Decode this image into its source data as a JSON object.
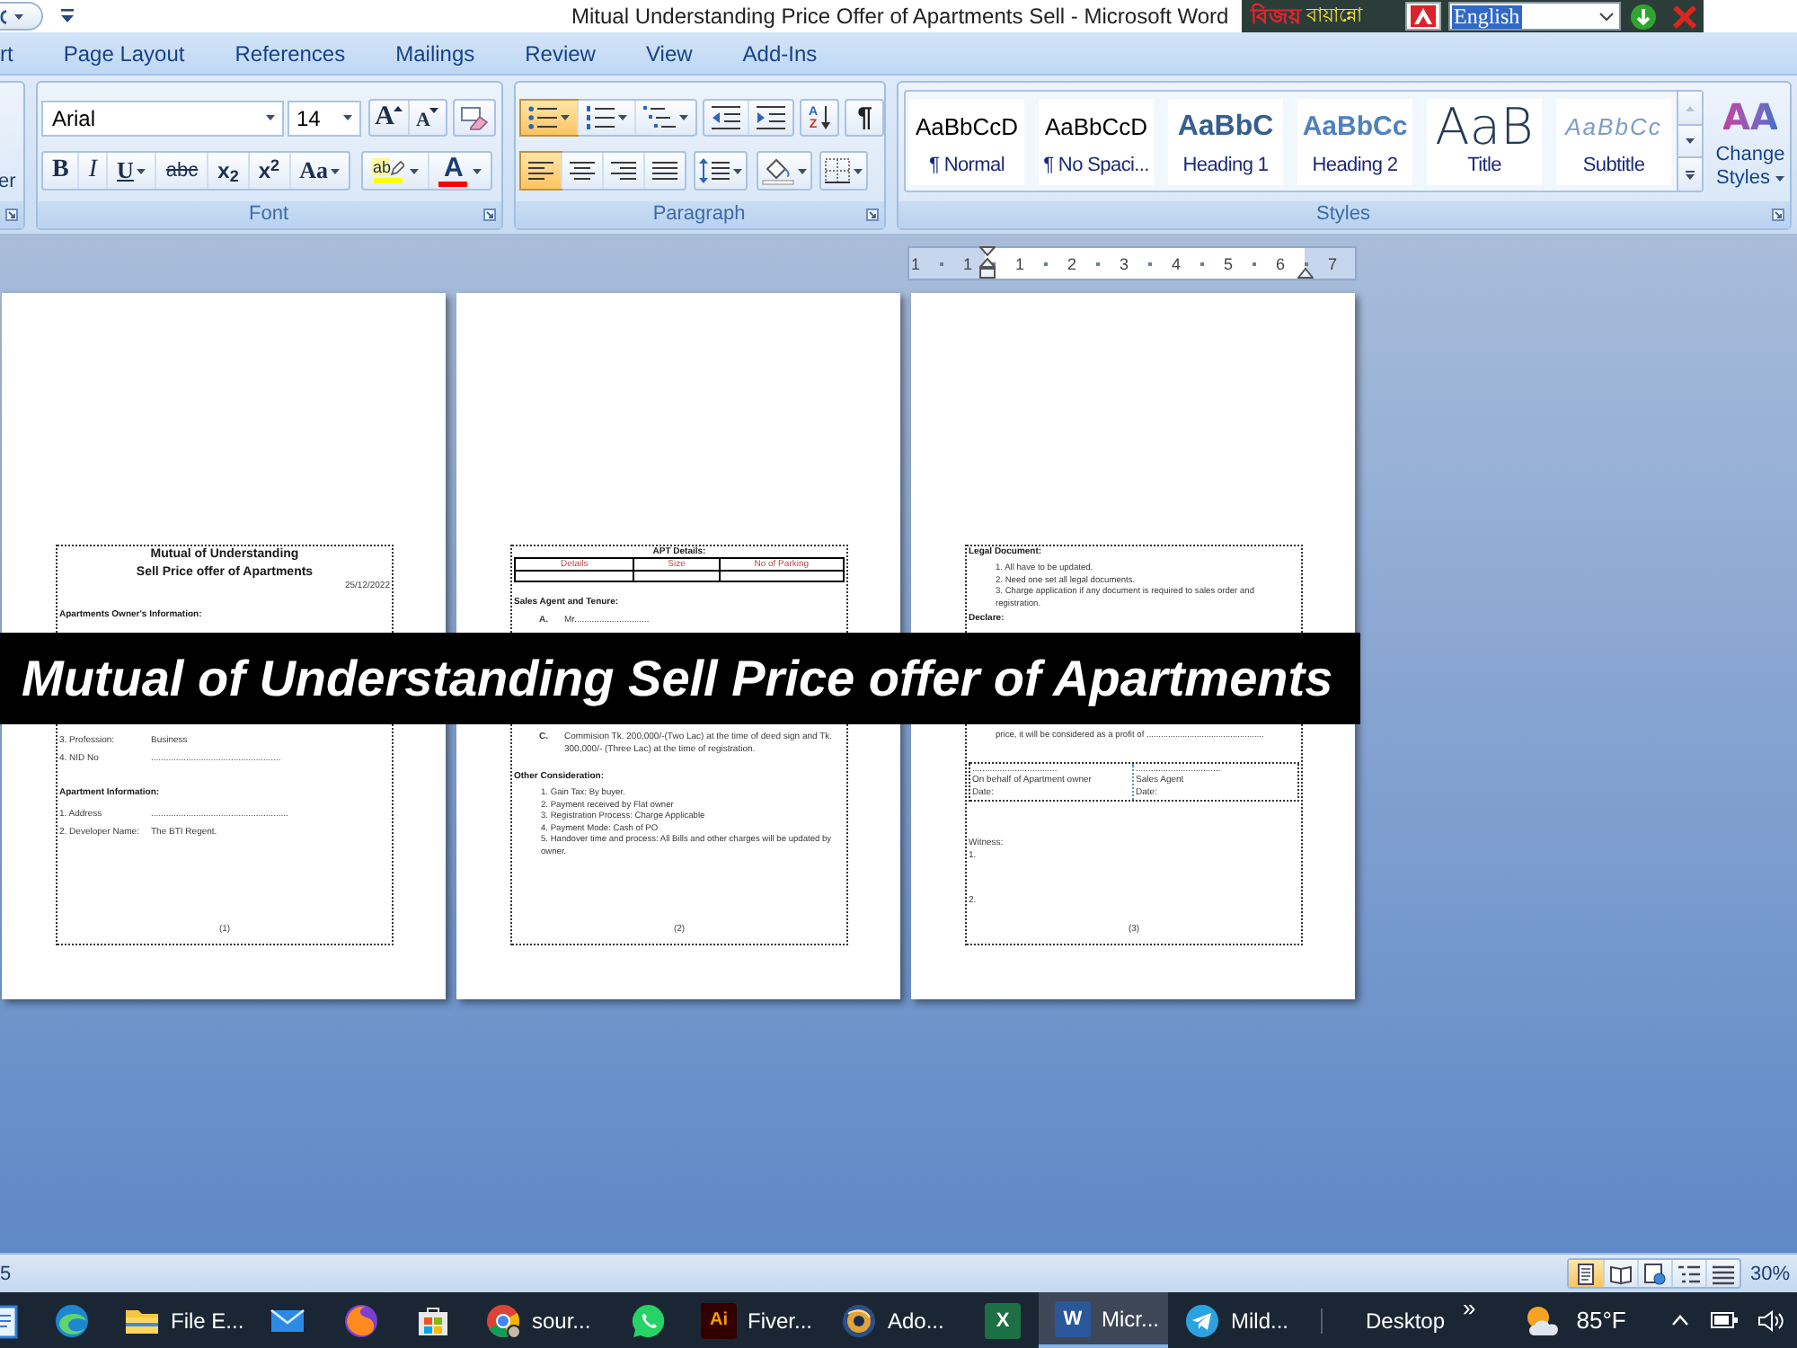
{
  "title_bar": {
    "title": "Mitual Understanding Price Offer of Apartments Sell - Microsoft Word"
  },
  "input_toolbar": {
    "logo": "বিজয়",
    "product": "বায়ান্নো",
    "language": "English"
  },
  "tabs": [
    {
      "label": "rt",
      "selected": false
    },
    {
      "label": "Page Layout",
      "selected": false
    },
    {
      "label": "References",
      "selected": false
    },
    {
      "label": "Mailings",
      "selected": false
    },
    {
      "label": "Review",
      "selected": false
    },
    {
      "label": "View",
      "selected": false
    },
    {
      "label": "Add-Ins",
      "selected": false
    }
  ],
  "clipboard_group": {
    "button_label": "er"
  },
  "font_group": {
    "label": "Font",
    "font_name": "Arial",
    "font_size": "14",
    "size_buttons": [
      {
        "kind": "grow",
        "glyph": "A"
      },
      {
        "kind": "shrink",
        "glyph": "A"
      }
    ],
    "format_buttons": [
      {
        "kind": "bold",
        "glyph": "B",
        "menu": false
      },
      {
        "kind": "italic",
        "glyph": "I",
        "menu": false
      },
      {
        "kind": "underline",
        "glyph": "U",
        "menu": true
      },
      {
        "kind": "strike",
        "glyph": "abc",
        "menu": false
      },
      {
        "kind": "subscript",
        "glyph": "x$_{2}$",
        "menu": false
      },
      {
        "kind": "superscript",
        "glyph": "x$^{2}$",
        "menu": false
      },
      {
        "kind": "case",
        "glyph": "Aa",
        "menu": true
      }
    ],
    "color_buttons": [
      {
        "kind": "highlight",
        "glyph": "ab",
        "color": "#ffff00"
      },
      {
        "kind": "font_color",
        "glyph": "A",
        "color": "#ff0000"
      }
    ]
  },
  "paragraph_group": {
    "label": "Paragraph",
    "rows": [
      [
        [
          {
            "kind": "bullets",
            "on": true,
            "menu": true
          },
          {
            "kind": "numbering",
            "on": false,
            "menu": true
          },
          {
            "kind": "multilevel",
            "on": false,
            "menu": true
          }
        ],
        [
          {
            "kind": "outdent",
            "on": false,
            "menu": false
          },
          {
            "kind": "indent",
            "on": false,
            "menu": false
          }
        ],
        [
          {
            "kind": "sort",
            "on": false,
            "menu": false,
            "glyphs": [
              "A",
              "Z"
            ]
          }
        ],
        [
          {
            "kind": "pilcrow",
            "on": false,
            "menu": false,
            "glyph": "¶"
          }
        ]
      ],
      [
        [
          {
            "kind": "align_left",
            "on": true,
            "menu": false
          },
          {
            "kind": "align_center",
            "on": false,
            "menu": false
          },
          {
            "kind": "align_right",
            "on": false,
            "menu": false
          },
          {
            "kind": "justify",
            "on": false,
            "menu": false
          }
        ],
        [
          {
            "kind": "line_spacing",
            "on": false,
            "menu": true
          }
        ],
        [
          {
            "kind": "shading",
            "on": false,
            "menu": true
          }
        ],
        [
          {
            "kind": "borders",
            "on": false,
            "menu": true
          }
        ]
      ]
    ]
  },
  "styles_group": {
    "label": "Styles",
    "gallery": [
      {
        "kind": "normal",
        "preview": "AaBbCcD",
        "label": "¶ Normal",
        "selected": false
      },
      {
        "kind": "no_spacing",
        "preview": "AaBbCcD",
        "label": "¶ No Spaci...",
        "selected": false
      },
      {
        "kind": "heading1",
        "preview": "AaBbC",
        "label": "Heading 1",
        "selected": false
      },
      {
        "kind": "heading2",
        "preview": "AaBbCc",
        "label": "Heading 2",
        "selected": false
      },
      {
        "kind": "title",
        "preview": "AaB",
        "label": "Title",
        "selected": false
      },
      {
        "kind": "subtitle",
        "preview": "AaBbCc",
        "label": "Subtitle",
        "selected": false
      }
    ],
    "scroll_up": {
      "disabled": true
    },
    "change_styles": {
      "glyph": "AA",
      "label": "Change Styles"
    }
  },
  "ruler": {
    "labels": [
      "1",
      "1",
      "1",
      "2",
      "3",
      "4",
      "5",
      "6",
      "7"
    ]
  },
  "pages": [
    {
      "top": [
        {
          "kind": "title",
          "text": "Mutual of Understanding"
        },
        {
          "kind": "title",
          "text": "Sell Price offer of Apartments"
        },
        {
          "kind": "date",
          "text": "25/12/2022"
        },
        {
          "kind": "heading",
          "text": "Apartments Owner's Information:"
        }
      ],
      "bottom": [
        {
          "kind": "field",
          "label": "3. Profession:",
          "value": "Business"
        },
        {
          "kind": "field",
          "label": "4. NID No",
          "value": "...................................................."
        },
        {
          "kind": "heading",
          "text": "Apartment Information:"
        },
        {
          "kind": "field",
          "label": "1. Address",
          "value": "......................................................."
        },
        {
          "kind": "field",
          "label": "2. Developer Name:",
          "value": "The BTI Regent."
        }
      ],
      "page_number": "(1)"
    },
    {
      "top": [
        {
          "kind": "center_heading",
          "text": "APT Details:"
        },
        {
          "kind": "table",
          "columns": [
            "Details",
            "Size",
            "No of Parking"
          ]
        },
        {
          "kind": "heading",
          "text": "Sales Agent and Tenure:"
        },
        {
          "kind": "lettered",
          "marker": "A.",
          "text": "Mr.............................."
        }
      ],
      "bottom": [
        {
          "kind": "lettered",
          "marker": "C.",
          "text": "Commision Tk. 200,000/-(Two Lac) at the time of deed sign and Tk. 300,000/- (Three Lac) at the time of registration."
        },
        {
          "kind": "heading",
          "text": "Other Consideration:"
        },
        {
          "kind": "list_item",
          "text": "1. Gain Tax: By buyer."
        },
        {
          "kind": "list_item",
          "text": "2. Payment received by Flat owner"
        },
        {
          "kind": "list_item",
          "text": "3. Registration Process: Charge Applicable"
        },
        {
          "kind": "list_item",
          "text": "4. Payment Mode: Cash of PO"
        },
        {
          "kind": "list_item",
          "text": "5. Handover time and process: All Bills and other charges will be updated by owner."
        }
      ],
      "page_number": "(2)"
    },
    {
      "top": [
        {
          "kind": "heading",
          "text": "Legal Document:"
        },
        {
          "kind": "list_item",
          "text": "1. All have to be updated."
        },
        {
          "kind": "list_item",
          "text": "2. Need one set all legal documents."
        },
        {
          "kind": "list_item",
          "text": "3. Charge application if any document is required to sales order and registration."
        },
        {
          "kind": "heading",
          "text": "Declare:"
        }
      ],
      "bottom": [
        {
          "kind": "list_item",
          "text": "price, it will be considered as a profit of ................................................."
        },
        {
          "kind": "signatures",
          "cells": [
            {
              "line": "..................................",
              "lines": [
                "On behalf of Apartment owner",
                "Date:"
              ]
            },
            {
              "line": "..................................",
              "lines": [
                "Sales Agent",
                "Date:"
              ]
            }
          ]
        },
        {
          "kind": "plain",
          "text": "Witness:"
        },
        {
          "kind": "slot",
          "text": "1."
        },
        {
          "kind": "slot",
          "text": "2."
        }
      ],
      "page_number": "(3)"
    }
  ],
  "banner": {
    "text": "Mutual of Understanding Sell Price offer of Apartments"
  },
  "status_bar": {
    "text": "5",
    "views": [
      {
        "kind": "print_layout",
        "selected": true
      },
      {
        "kind": "reading",
        "selected": false
      },
      {
        "kind": "web",
        "selected": false
      },
      {
        "kind": "outline",
        "selected": false
      },
      {
        "kind": "draft",
        "selected": false
      }
    ],
    "zoom": "30%"
  },
  "taskbar": {
    "items": [
      {
        "kind": "notepad",
        "selected": false
      },
      {
        "kind": "edge",
        "selected": false
      },
      {
        "kind": "folder",
        "label": "File E...",
        "selected": false
      },
      {
        "kind": "mail",
        "selected": false
      },
      {
        "kind": "fox",
        "selected": false
      },
      {
        "kind": "bag",
        "selected": false
      },
      {
        "kind": "chrome",
        "label": "sour...",
        "selected": false
      },
      {
        "kind": "chat",
        "selected": false
      },
      {
        "kind": "ai",
        "glyph": "Ai",
        "label": "Fiver...",
        "selected": false
      },
      {
        "kind": "disc",
        "label": "Ado...",
        "selected": false
      },
      {
        "kind": "sheet",
        "glyph": "X",
        "selected": false
      },
      {
        "kind": "doc",
        "glyph": "W",
        "label": "Micr...",
        "selected": true
      },
      {
        "kind": "plane",
        "label": "Mild...",
        "selected": false
      }
    ],
    "desktop_label": "Desktop",
    "overflow": "»",
    "weather": "85°F"
  }
}
